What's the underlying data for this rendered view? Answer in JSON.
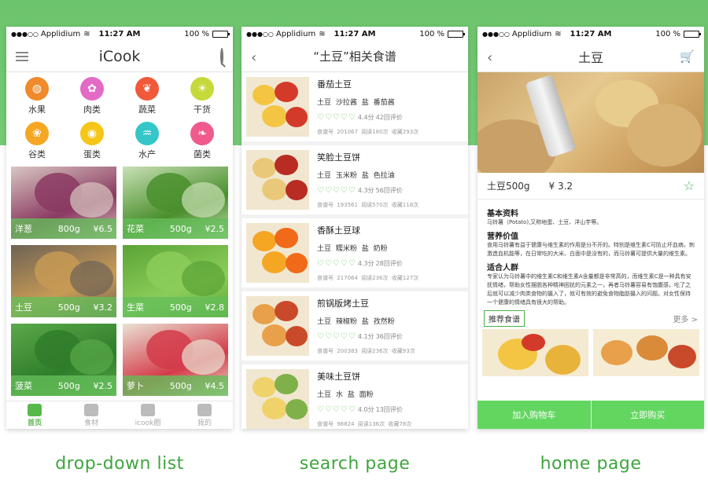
{
  "statusbar": {
    "carrier": "Applidium",
    "time": "11:27 AM",
    "battery": "100 %",
    "battery_level": 1.0
  },
  "screen1": {
    "title": "iCook",
    "categories": [
      {
        "label": "水果",
        "color": "#f08a2a",
        "icon": "fruit-icon"
      },
      {
        "label": "肉类",
        "color": "#e36bc6",
        "icon": "meat-icon"
      },
      {
        "label": "蔬菜",
        "color": "#f05a3a",
        "icon": "vegetable-icon"
      },
      {
        "label": "干货",
        "color": "#c7d93a",
        "icon": "dried-goods-icon"
      },
      {
        "label": "谷类",
        "color": "#f5a623",
        "icon": "grain-icon"
      },
      {
        "label": "蛋类",
        "color": "#f5c518",
        "icon": "egg-icon"
      },
      {
        "label": "水产",
        "color": "#34c6c9",
        "icon": "seafood-icon"
      },
      {
        "label": "菌类",
        "color": "#f05a8c",
        "icon": "mushroom-icon"
      }
    ],
    "items": [
      {
        "name": "洋葱",
        "weight": "800g",
        "price": "¥6.5",
        "c1": "#8b3a62",
        "c2": "#d9c7c2"
      },
      {
        "name": "花菜",
        "weight": "500g",
        "price": "¥2.5",
        "c1": "#4a8f2d",
        "c2": "#c9e0b5"
      },
      {
        "name": "土豆",
        "weight": "500g",
        "price": "¥3.2",
        "c1": "#c79a55",
        "c2": "#6d6255"
      },
      {
        "name": "生菜",
        "weight": "500g",
        "price": "¥2.8",
        "c1": "#8ccd5a",
        "c2": "#5aa336"
      },
      {
        "name": "菠菜",
        "weight": "500g",
        "price": "¥2.5",
        "c1": "#2f7d2a",
        "c2": "#5aa94a"
      },
      {
        "name": "萝卜",
        "weight": "500g",
        "price": "¥4.5",
        "c1": "#d43b4a",
        "c2": "#e9e2d3"
      }
    ],
    "tabs": [
      {
        "label": "首页",
        "icon": "home-icon",
        "active": true
      },
      {
        "label": "食材",
        "icon": "ingredients-icon",
        "active": false
      },
      {
        "label": "icook圈",
        "icon": "community-icon",
        "active": false
      },
      {
        "label": "我的",
        "icon": "profile-icon",
        "active": false
      }
    ]
  },
  "screen2": {
    "title": "“土豆”相关食谱",
    "recipes": [
      {
        "name": "番茄土豆",
        "ingredients": "土豆  沙拉酱  盐  番茄酱",
        "score": "4.4分",
        "reviews": "42回评价",
        "id": "食谱号 201067",
        "reads": "阅读180次",
        "favs": "收藏293次",
        "c1": "#f3c542",
        "c2": "#d43a2a"
      },
      {
        "name": "笑脸土豆饼",
        "ingredients": "土豆  玉米粉  盐  色拉油",
        "score": "4.3分",
        "reviews": "56回评价",
        "id": "食谱号 193561",
        "reads": "阅读570次",
        "favs": "收藏118次",
        "c1": "#e9c979",
        "c2": "#b82c24"
      },
      {
        "name": "香酥土豆球",
        "ingredients": "土豆  糯米粉  盐  奶粉",
        "score": "4.3分",
        "reviews": "28回评价",
        "id": "食谱号 217064",
        "reads": "阅读236次",
        "favs": "收藏127次",
        "c1": "#f5a623",
        "c2": "#f06a1a"
      },
      {
        "name": "煎锅版烤土豆",
        "ingredients": "土豆  辣椒粉  盐  孜然粉",
        "score": "4.1分",
        "reviews": "36回评价",
        "id": "食谱号 200383",
        "reads": "阅读236次",
        "favs": "收藏93次",
        "c1": "#e9a04a",
        "c2": "#c94a2a"
      },
      {
        "name": "美味土豆饼",
        "ingredients": "土豆  水  盐  面粉",
        "score": "4.0分",
        "reviews": "13回评价",
        "id": "食谱号 98824",
        "reads": "阅读136次",
        "favs": "收藏78次",
        "c1": "#f0d26a",
        "c2": "#7fb04a"
      }
    ]
  },
  "screen3": {
    "title": "土豆",
    "name_weight": "土豆500g",
    "price": "¥ 3.2",
    "sections": [
      {
        "heading": "基本资料",
        "text": "马铃薯（Potato),又称地蛋、土豆、洋山芋等。"
      },
      {
        "heading": "营养价值",
        "text": "食用马铃薯有益于健康与维生素的作用是分不开的。特别是维生素C可防止坏血病，刺激造血机能等，在日常吃的大米、白面中是没有的，而马铃薯可提供大量的维生素。"
      },
      {
        "heading": "适合人群",
        "text": "专家认为马铃薯中的维生素C和维生素A含量都是非常高的，而维生素C是一种具有安抚情绪，帮助女性摆脱各种精神困扰的元素之一，再者马铃薯容易有饱腹感，吃了之后就可以减少肉类食物的摄入了，就可有效的避免食物脂肪摄入的问题。对女性保持一个健康的情绪具有很大的帮助。"
      }
    ],
    "recommend_label": "推荐食谱",
    "more_label": "更多 >",
    "add_cart": "加入购物车",
    "buy_now": "立即购买"
  },
  "captions": {
    "c1": "drop-down list",
    "c2": "search page",
    "c3": "home page"
  }
}
